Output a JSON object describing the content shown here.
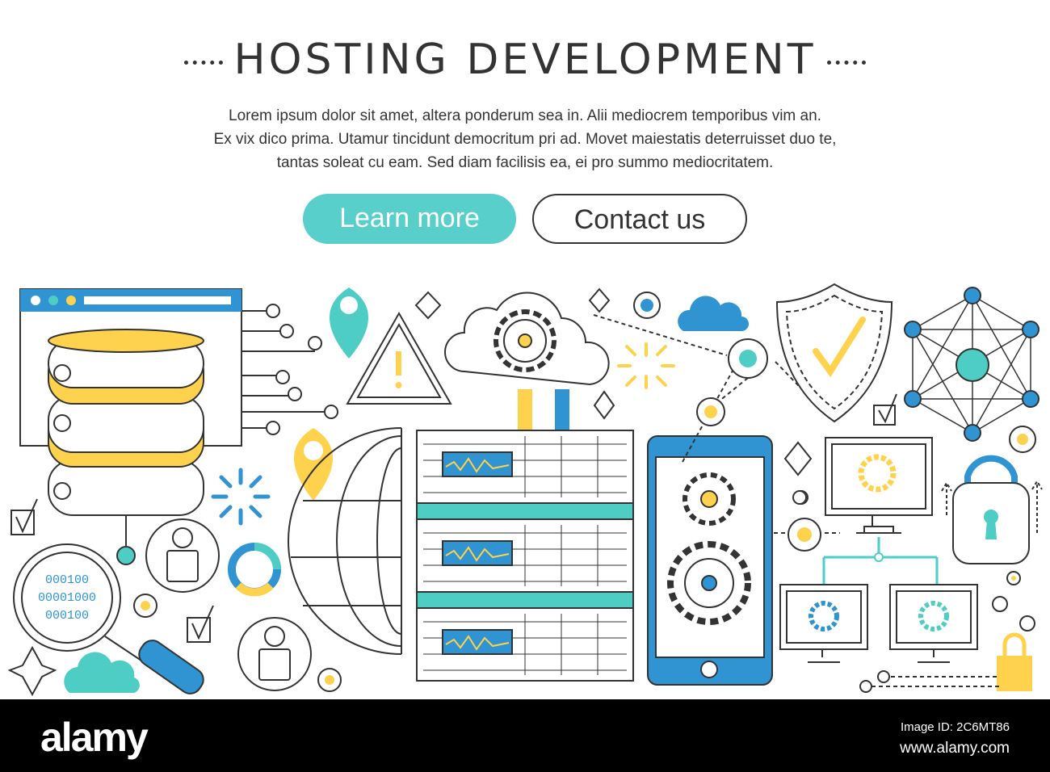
{
  "header": {
    "title": "HOSTING DEVELOPMENT"
  },
  "intro": {
    "lines": [
      "Lorem ipsum dolor sit amet, altera ponderum sea in. Alii mediocrem temporibus vim an.",
      "Ex vix dico prima. Utamur tincidunt democritum pri ad. Movet maiestatis deterruisset duo te,",
      "tantas soleat cu eam. Sed diam facilisis ea, ei pro summo mediocritatem."
    ]
  },
  "buttons": {
    "learn_more": "Learn more",
    "contact_us": "Contact us"
  },
  "illustration": {
    "binary": [
      "000100",
      "00001000",
      "000100"
    ]
  },
  "colors": {
    "blue": "#2f94d1",
    "teal": "#4ecdc4",
    "yellow": "#ffd24d",
    "outline": "#333333"
  },
  "watermark": {
    "logo": "alamy",
    "image_id": "Image ID: 2C6MT86",
    "site": "www.alamy.com"
  }
}
